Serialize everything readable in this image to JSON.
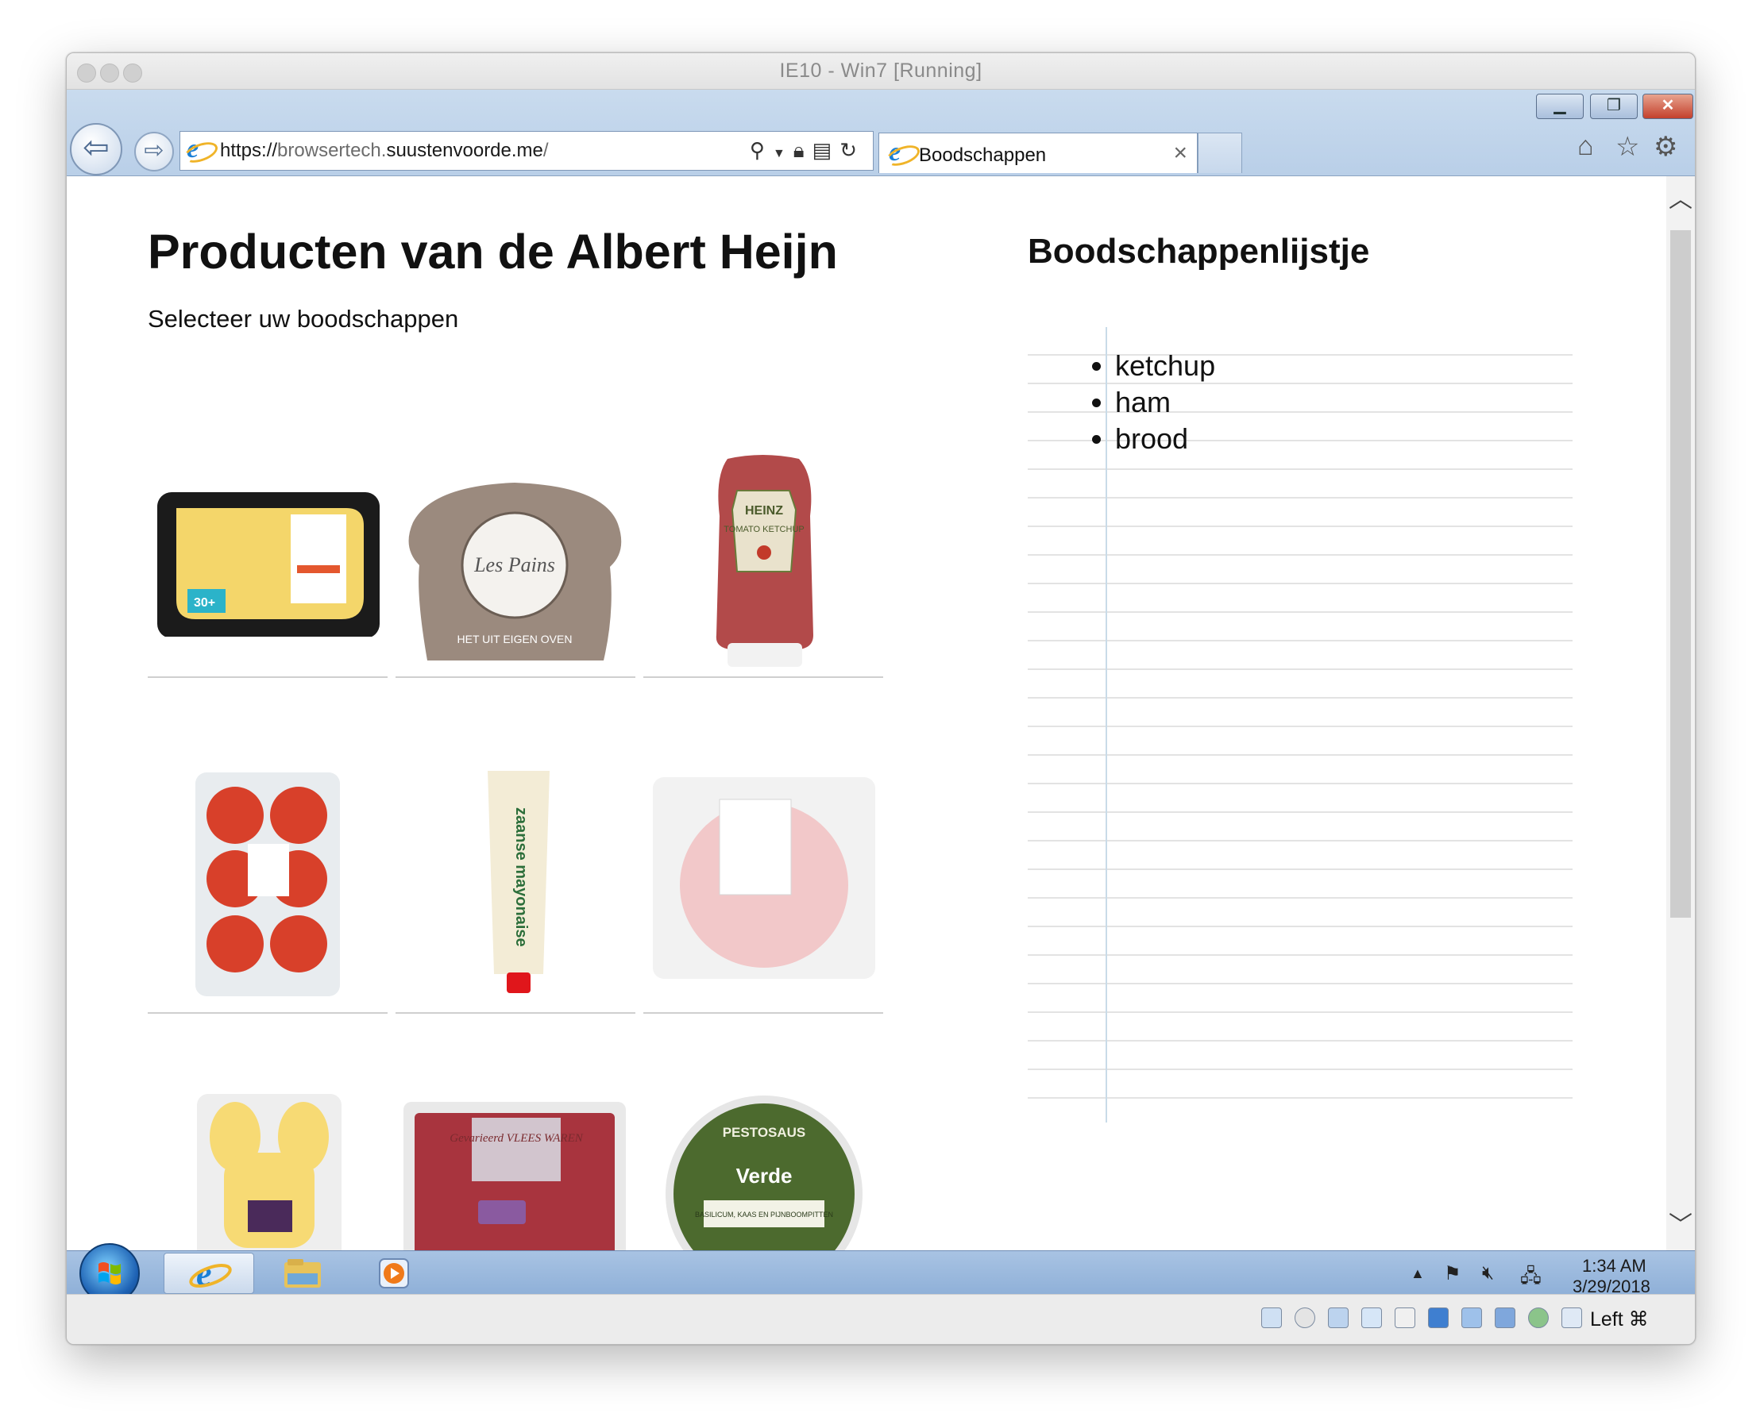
{
  "mac_window": {
    "title": "IE10 - Win7 [Running]"
  },
  "browser": {
    "address": {
      "scheme": "https://",
      "host_prefix": "browsertech.",
      "host_main": "suustenvoorde.me",
      "path": "/"
    },
    "tab": {
      "title": "Boodschappen"
    }
  },
  "page": {
    "title": "Producten van de Albert Heijn",
    "subtitle": "Selecteer uw boodschappen",
    "products": [
      "cheese",
      "bread",
      "ketchup",
      "tomatoes",
      "mayonnaise",
      "ham",
      "cheese-bunny",
      "minced-meat",
      "pesto"
    ],
    "shopping_list": {
      "title": "Boodschappenlijstje",
      "items": [
        "ketchup",
        "ham",
        "brood"
      ]
    }
  },
  "product_texts": {
    "cheese_badge": "30+",
    "bread_label": "Les Pains",
    "bread_tagline": "HET UIT EIGEN OVEN",
    "ketchup_brand": "HEINZ",
    "ketchup_label": "TOMATO KETCHUP",
    "mayo_label": "zaanse mayonaise",
    "meat_label": "Gevarieerd VLEES WAREN",
    "pesto_title": "PESTOSAUS",
    "pesto_name": "Verde",
    "pesto_sub": "BASILICUM, KAAS EN PIJNBOOMPITTEN"
  },
  "taskbar": {
    "time": "1:34 AM",
    "date": "3/29/2018"
  },
  "vbox": {
    "host_key": "Left ⌘"
  },
  "colors": {
    "ie_chrome": "#c2d6ec",
    "taskbar": "#9bb9de",
    "close_red": "#c3402c"
  }
}
